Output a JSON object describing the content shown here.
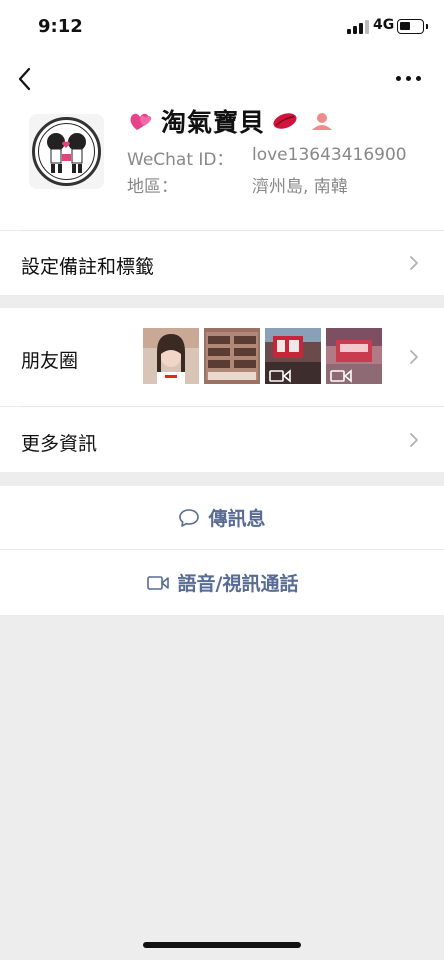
{
  "status_bar": {
    "time": "9:12",
    "network": "4G"
  },
  "profile": {
    "name": "淘氣寶貝",
    "wechat_id_label": "WeChat ID：",
    "wechat_id_value": "love13643416900",
    "region_label": "地區：",
    "region_value": "濟州島, 南韓"
  },
  "rows": {
    "remark_label": "設定備註和標籤",
    "moments_label": "朋友圈",
    "more_info_label": "更多資訊"
  },
  "actions": {
    "message_label": "傳訊息",
    "call_label": "語音/視訊通話"
  },
  "colors": {
    "link": "#576b95",
    "background": "#ededed"
  },
  "icons": [
    "back-arrow-icon",
    "more-dots-icon",
    "heart-emoji-icon",
    "lips-emoji-icon",
    "person-icon",
    "chevron-right-icon",
    "chat-bubble-icon",
    "video-camera-icon"
  ]
}
